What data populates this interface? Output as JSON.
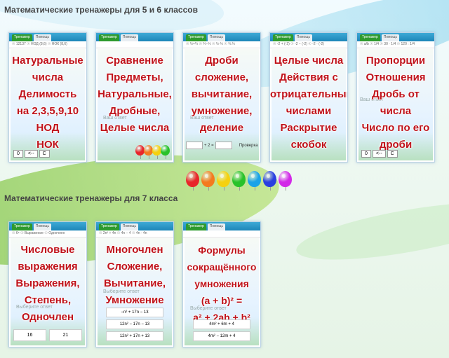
{
  "section1": {
    "title": "Математические тренажеры для 5 и 6 классов",
    "cards": [
      {
        "tabs": [
          "Тренажер",
          "Помощь"
        ],
        "topic": "☉ 12137  ☉ НОД (8,6)  ☉ НОК (8,6)",
        "lines": [
          "Натуральные",
          "числа",
          "Делимость",
          "на 2,3,5,9,10",
          "НОД",
          "НОК"
        ],
        "keys": [
          "0",
          "<--",
          "C"
        ]
      },
      {
        "tabs": [
          "Тренажер",
          "Помощь"
        ],
        "topic": "",
        "lines": [
          "Сравнение",
          "Предметы,",
          "Натуральные,",
          "Дробные,",
          "Целые числа"
        ],
        "ghost": "Ваш ответ"
      },
      {
        "tabs": [
          "Тренажер",
          "Помощь"
        ],
        "topic": "☉ ½+¼  ☉ ¾−¼  ☉ ½·¼  ☉ ¾:¼",
        "lines": [
          "Дроби",
          "сложение,",
          "вычитание,",
          "умножение,",
          "деление"
        ],
        "ghost": "Ваш ответ",
        "check_label": "Проверка",
        "plus_sign": "+ 2 ="
      },
      {
        "tabs": [
          "Тренажер",
          "Помощь"
        ],
        "topic": "☉ -2 + (-2)  ☉ -2 − (-2)  ☉ -2 · (-2)",
        "lines": [
          "Целые числа",
          "Действия с",
          "отрицательным",
          "числами",
          "Раскрытие",
          "скобок"
        ]
      },
      {
        "tabs": [
          "Тренажер",
          "Помощь"
        ],
        "topic": "☉ a/b  ☉ 1/4  ☉ 30 · 1/4  ☉ 120 : 1/4",
        "lines": [
          "Пропорции",
          "Отношения",
          "Дробь от",
          "числа",
          "Число по его",
          "дроби"
        ],
        "ghost": "Ваш ответ",
        "keys": [
          "0",
          "<--",
          "C"
        ]
      }
    ]
  },
  "section2": {
    "title": "Математические тренажеры для 7 класса",
    "cards": [
      {
        "tabs": [
          "Тренажер",
          "Помощь"
        ],
        "topic": "☉ 6⁵  ☉ Выражение  ☉ Одночлен",
        "lines": [
          "Числовые",
          "выражения",
          "Выражения,",
          "Степень,",
          "Одночлен"
        ],
        "ghost": "Выберите ответ",
        "answers": [
          "16",
          "21"
        ]
      },
      {
        "tabs": [
          "Тренажер",
          "Помощь"
        ],
        "topic": "☉ 2n² + 4n  ☉ 4n − 4  ☉ 4n · 4n",
        "lines": [
          "Многочлен",
          "Сложение,",
          "Вычитание,",
          "Умножение"
        ],
        "ghost": "Выберите ответ",
        "answers": [
          "−n² + 17n − 13",
          "12n² − 17n − 13",
          "12n² + 17n + 13"
        ]
      },
      {
        "tabs": [
          "Тренажер",
          "Помощь"
        ],
        "topic": "",
        "lines": [
          "Формулы",
          "сокращённого",
          "умножения",
          "(a + b)² =",
          "a² + 2ab + b²"
        ],
        "ghost": "Выберите ответ",
        "answers": [
          "4m² + 6m + 4",
          "4m² − 12m + 4"
        ]
      }
    ]
  },
  "balloons": {
    "colors": [
      "#e8262a",
      "#f47a1f",
      "#f5d10f",
      "#28c22a",
      "#1aa3e8",
      "#2a3fe0",
      "#d22ae8"
    ],
    "small_colors": [
      "#e8262a",
      "#f47a1f",
      "#f5d10f",
      "#28c22a"
    ]
  }
}
